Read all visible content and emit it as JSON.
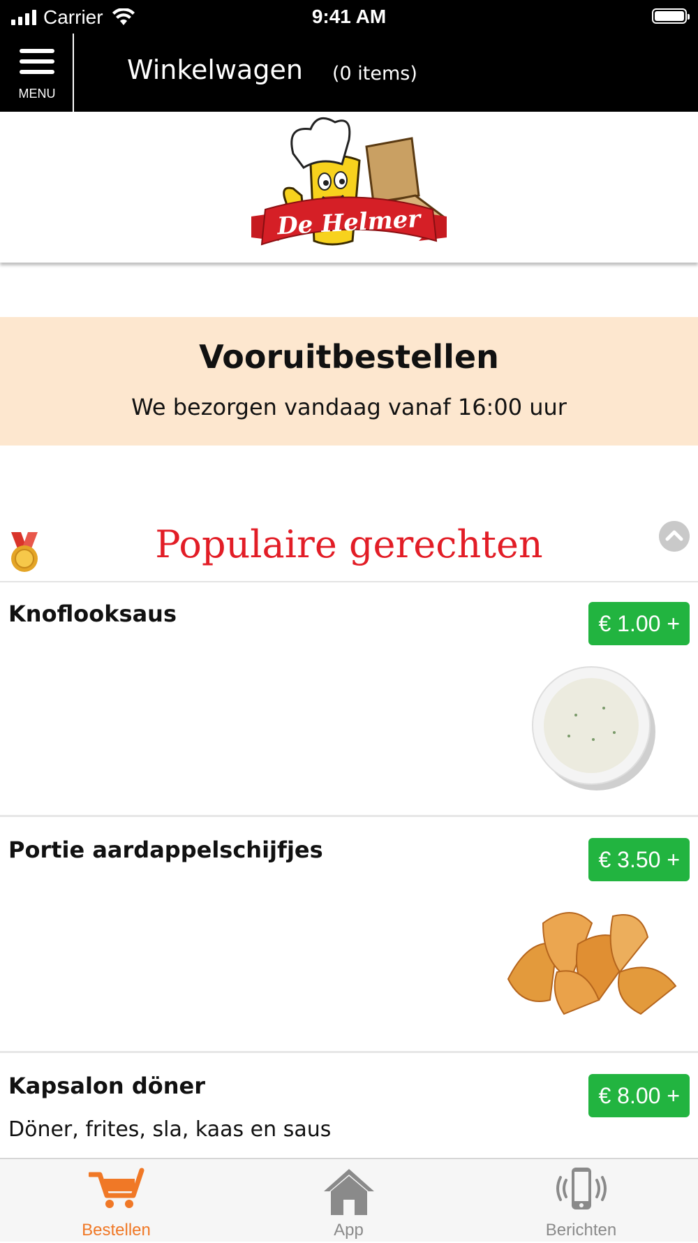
{
  "status_bar": {
    "carrier": "Carrier",
    "time": "9:41 AM"
  },
  "header": {
    "menu_label": "MENU",
    "title": "Winkelwagen",
    "item_count": "(0 items)"
  },
  "logo": {
    "brand_text": "De Helmer"
  },
  "banner": {
    "title": "Vooruitbestellen",
    "subtitle": "We bezorgen vandaag vanaf 16:00 uur"
  },
  "section": {
    "title": "Populaire gerechten",
    "icon": "medal-icon"
  },
  "items": [
    {
      "name": "Knoflooksaus",
      "description": "",
      "price": "€ 1.00 +",
      "image": "garlic-sauce-bowl"
    },
    {
      "name": "Portie aardappelschijfjes",
      "description": "",
      "price": "€ 3.50 +",
      "image": "potato-wedges"
    },
    {
      "name": "Kapsalon döner",
      "description": "Döner, frites, sla, kaas en saus",
      "price": "€ 8.00 +",
      "image": ""
    }
  ],
  "tabbar": {
    "tabs": [
      {
        "label": "Bestellen",
        "icon": "cart-icon",
        "active": true
      },
      {
        "label": "App",
        "icon": "home-icon",
        "active": false
      },
      {
        "label": "Berichten",
        "icon": "phone-vibrate-icon",
        "active": false
      }
    ]
  },
  "colors": {
    "accent_orange": "#f07826",
    "price_green": "#22b440",
    "section_red": "#e21d26",
    "banner_bg": "#fde7cf"
  }
}
